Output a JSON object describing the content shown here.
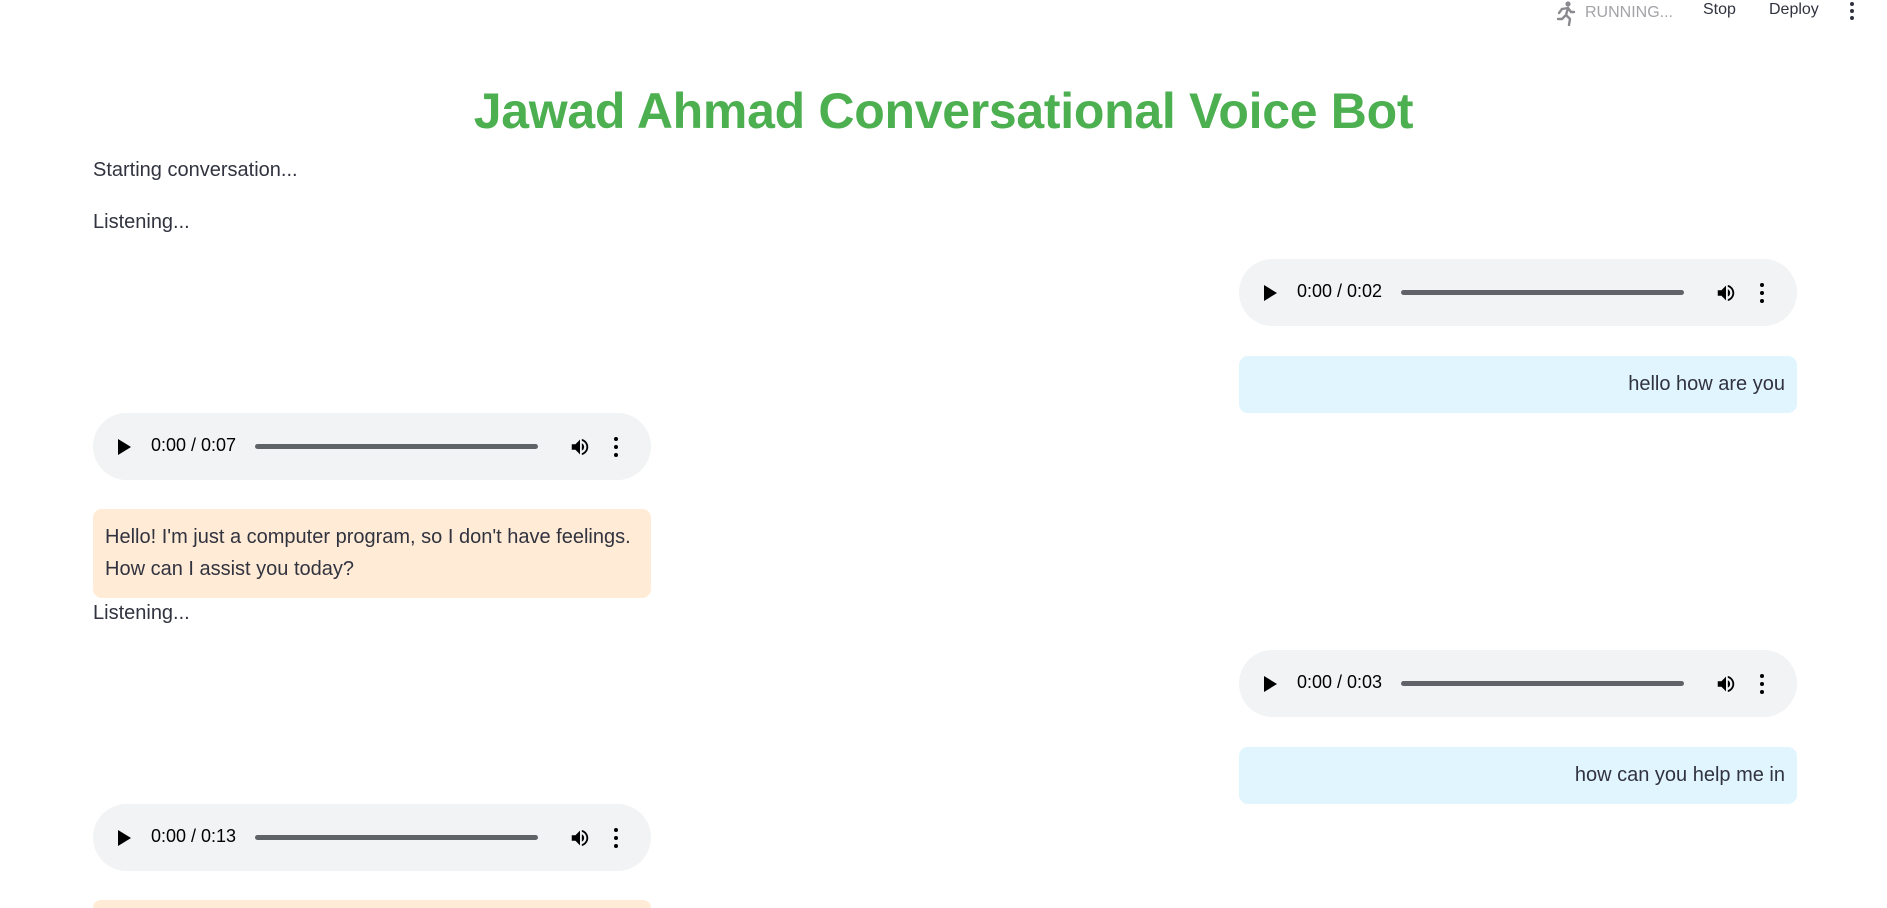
{
  "header": {
    "status_text": "RUNNING...",
    "stop_label": "Stop",
    "deploy_label": "Deploy",
    "icons": {
      "running": "running-person-icon",
      "menu": "kebab-menu-icon"
    }
  },
  "page": {
    "title": "Jawad Ahmad Conversational Voice Bot",
    "title_color": "#4caf50"
  },
  "conversation": {
    "start_status": "Starting conversation...",
    "listening_1": "Listening...",
    "listening_2": "Listening...",
    "user_audio_1": {
      "time": "0:00 / 0:02"
    },
    "user_message_1": "hello how are you",
    "bot_audio_1": {
      "time": "0:00 / 0:07"
    },
    "bot_message_1": "Hello! I'm just a computer program, so I don't have feelings. How can I assist you today?",
    "user_audio_2": {
      "time": "0:00 / 0:03"
    },
    "user_message_2": "how can you help me in",
    "bot_audio_2": {
      "time": "0:00 / 0:13"
    },
    "colors": {
      "user_bubble": "#e1f5fe",
      "bot_bubble": "#ffebd6",
      "audio_player": "#f1f3f4"
    }
  }
}
